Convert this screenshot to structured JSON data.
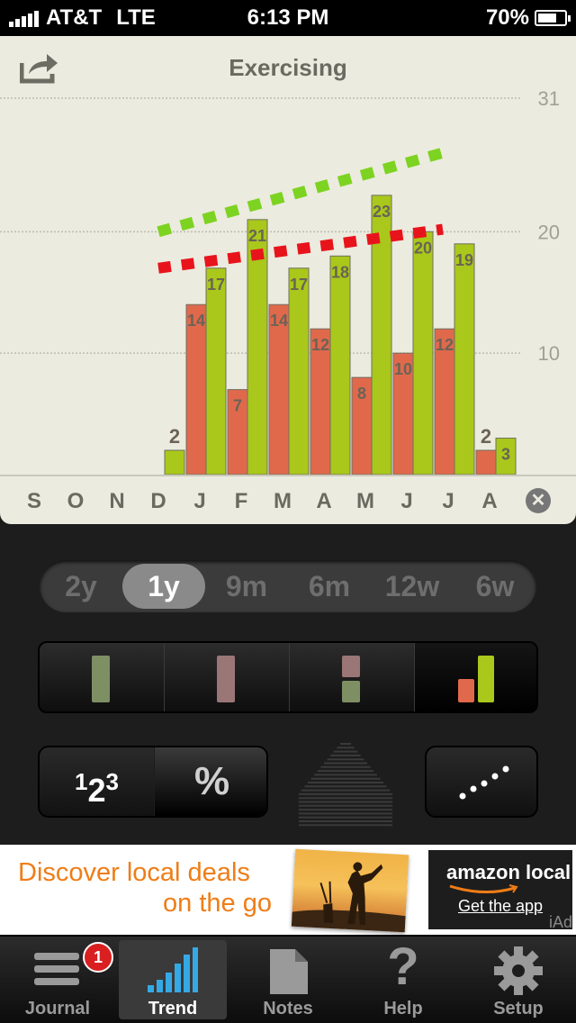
{
  "status_bar": {
    "carrier": "AT&T",
    "network": "LTE",
    "time": "6:13 PM",
    "battery": "70%",
    "battery_level": 0.7
  },
  "header": {
    "title": "Exercising",
    "share_icon": "share-icon"
  },
  "chart_data": {
    "type": "bar",
    "title": "Exercising",
    "categories": [
      "S",
      "O",
      "N",
      "D",
      "J",
      "F",
      "M",
      "A",
      "M",
      "J",
      "J",
      "A"
    ],
    "series": [
      {
        "values": [
          null,
          null,
          null,
          null,
          14,
          7,
          14,
          12,
          8,
          10,
          12,
          2
        ],
        "color": "#e0694c"
      },
      {
        "values": [
          null,
          null,
          null,
          2,
          17,
          21,
          17,
          18,
          23,
          20,
          19,
          3
        ],
        "color": "#a9c81b"
      }
    ],
    "trend_lines": [
      {
        "color": "#7dd321",
        "start": 20,
        "end": 26.5
      },
      {
        "color": "#e8141c",
        "start": 17,
        "end": 20.2
      }
    ],
    "y_ticks": [
      "31",
      "20",
      "10"
    ],
    "ylim": [
      0,
      31
    ],
    "grid": true
  },
  "chart_controls": {
    "close_label": "✕"
  },
  "range_selector": {
    "options": [
      "2y",
      "1y",
      "9m",
      "6m",
      "12w",
      "6w"
    ],
    "selected": "1y"
  },
  "view_modes": [
    "green-bar",
    "red-bar",
    "stacked",
    "side-by-side"
  ],
  "number_toggle": {
    "count_label": {
      "a": "1",
      "b": "2",
      "c": "3"
    },
    "percent_label": "%"
  },
  "ad": {
    "headline_1": "Discover local deals",
    "headline_2": "on the go",
    "brand": "amazon local",
    "cta": "Get the app",
    "network": "iAd"
  },
  "tabbar": {
    "journal": "Journal",
    "journal_badge": "1",
    "trend": "Trend",
    "notes": "Notes",
    "help": "Help",
    "setup": "Setup"
  },
  "colors": {
    "red_series": "#e0694c",
    "green_series": "#a9c81b",
    "panel_bg": "#ecebdf",
    "ad_orange": "#ef7d17"
  }
}
